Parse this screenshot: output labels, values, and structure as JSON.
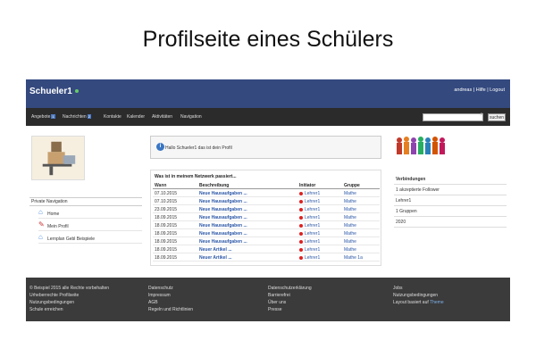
{
  "slide_title": "Profilseite eines Schülers",
  "topbar": {
    "brand": "Schueler1",
    "user_links": "andreas | Hilfe | Logout"
  },
  "nav": {
    "items": [
      "Angebote",
      "Nachrichten",
      "Kontakte",
      "Kalender",
      "Aktivitäten",
      "Navigation"
    ],
    "badges": {
      "Angebote": "1",
      "Nachrichten": "2"
    },
    "search_placeholder": "",
    "search_button": "suchen"
  },
  "private_nav": {
    "header": "Private Navigation",
    "items": [
      {
        "label": "Home",
        "icon": "home-icon"
      },
      {
        "label": "Mein Profil",
        "icon": "pencil-icon"
      },
      {
        "label": "Lernplan Gebl Beispiele",
        "icon": "home-icon"
      }
    ]
  },
  "info": {
    "text": "Hallo Schueler1 das ist dein Profil"
  },
  "news": {
    "title": "Was ist in meinem Netzwerk passiert...",
    "columns": [
      "Wann",
      "Beschreibung",
      "Initiator",
      "Gruppe"
    ],
    "rows": [
      [
        "07.10.2015",
        "Neue Hausaufgaben ...",
        "Lehrer1",
        "Mathe"
      ],
      [
        "07.10.2015",
        "Neue Hausaufgaben ...",
        "Lehrer1",
        "Mathe"
      ],
      [
        "23.09.2015",
        "Neue Hausaufgaben ...",
        "Lehrer1",
        "Mathe"
      ],
      [
        "18.09.2015",
        "Neue Hausaufgaben ...",
        "Lehrer1",
        "Mathe"
      ],
      [
        "18.09.2015",
        "Neue Hausaufgaben ...",
        "Lehrer1",
        "Mathe"
      ],
      [
        "18.09.2015",
        "Neue Hausaufgaben ...",
        "Lehrer1",
        "Mathe"
      ],
      [
        "18.09.2015",
        "Neue Hausaufgaben ...",
        "Lehrer1",
        "Mathe"
      ],
      [
        "18.09.2015",
        "Neuer Artikel ...",
        "Lehrer1",
        "Mathe"
      ],
      [
        "18.09.2015",
        "Neuer Artikel ...",
        "Lehrer1",
        "Mathe 1a"
      ]
    ]
  },
  "right_panel": {
    "items": [
      "Verbindungen",
      "1 akzeptierte Follower",
      "Lehrer1",
      "1 Gruppen",
      "2020"
    ]
  },
  "footer": {
    "col1": [
      "© Beispiel 2015 alle Rechte vorbehalten",
      "Urheberrechte Profilseite",
      "Nutzungsbedingungen",
      "Schule erreichen"
    ],
    "col2": [
      "Datenschutz",
      "Impressum",
      "AGB",
      "Regeln und Richtlinien"
    ],
    "col3": [
      "Datenschutzerklärung",
      "Barrierefrei",
      "Über uns",
      "Presse"
    ],
    "col4": [
      "Jobs",
      "Nutzungsbedingungen",
      "Layout basiert auf",
      "Theme"
    ],
    "highlight_color": "#7fb0e8"
  },
  "colors": {
    "topbar": "#34497e",
    "navbar": "#2b2b2b",
    "footer": "#3b3b3b",
    "link": "#2a56a6"
  }
}
